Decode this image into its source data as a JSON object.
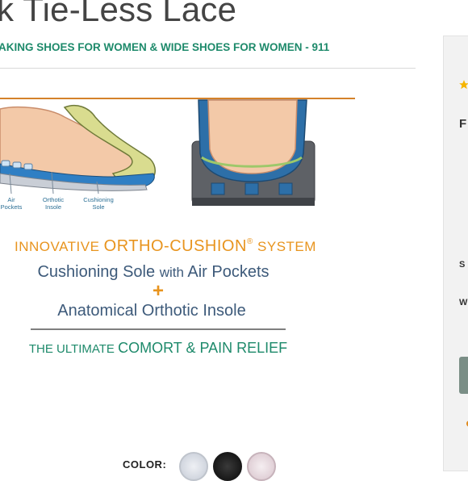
{
  "product": {
    "title": "k Tie-Less Lace",
    "subtitle": "AKING SHOES FOR WOMEN & WIDE SHOES FOR WOMEN - 911"
  },
  "image": {
    "callouts": [
      {
        "line1": "Air",
        "line2": "Pockets"
      },
      {
        "line1": "Orthotic",
        "line2": "Insole"
      },
      {
        "line1": "Cushioning",
        "line2": "Sole"
      }
    ],
    "headline_pre": "INNOVATIVE ",
    "headline_brand": "ORTHO-CUSHION",
    "headline_reg": "®",
    "headline_post": " SYSTEM",
    "line_a_1": "Cushioning Sole ",
    "line_a_2": "with",
    "line_a_3": " Air Pockets",
    "plus": "+",
    "line_b": "Anatomical Orthotic Insole",
    "tagline_1": "THE ULTIMATE ",
    "tagline_2": "COMORT & PAIN RELIEF"
  },
  "color": {
    "label": "COLOR:",
    "swatches": [
      "light-gray",
      "black",
      "pink"
    ]
  },
  "side_panel": {
    "line1": "F",
    "line2": "S",
    "line3": "W"
  },
  "colors": {
    "brand_green": "#1e8a6b",
    "accent_orange": "#e8941e",
    "text_blue": "#3d5a7a"
  }
}
